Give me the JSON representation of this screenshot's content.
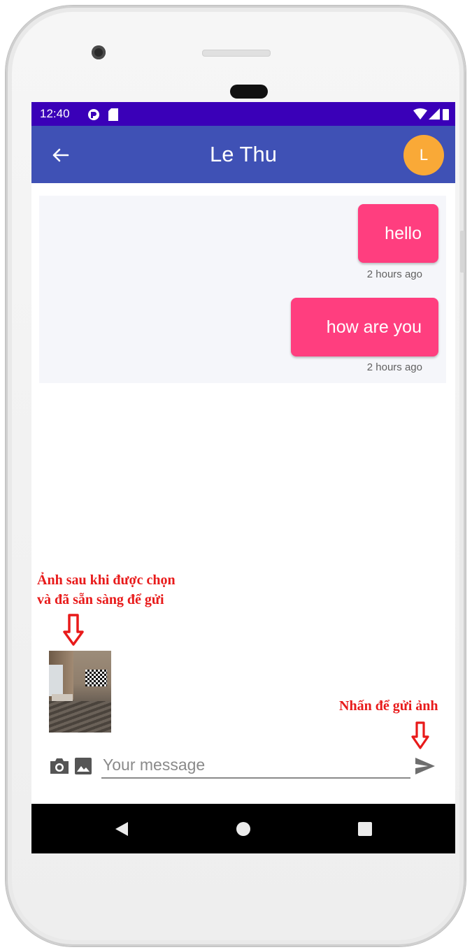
{
  "status_bar": {
    "time": "12:40"
  },
  "app_bar": {
    "title": "Le Thu",
    "avatar_initial": "L"
  },
  "messages": [
    {
      "text": "hello",
      "time": "2 hours ago"
    },
    {
      "text": "how are you",
      "time": "2 hours ago"
    }
  ],
  "composer": {
    "placeholder": "Your message"
  },
  "annotations": {
    "image_note_line1": "Ảnh sau khi được chọn",
    "image_note_line2": "và đã sẵn sàng để gửi",
    "send_note": "Nhấn để gửi ảnh"
  },
  "colors": {
    "status_bar": "#3a00b8",
    "app_bar": "#3f51b5",
    "bubble": "#ff3e7f",
    "avatar": "#f9a937",
    "annotation": "#e81a1a"
  },
  "icons": [
    "back-arrow-icon",
    "camera-icon",
    "image-icon",
    "send-icon",
    "wifi-icon",
    "signal-icon",
    "battery-icon",
    "nav-back-icon",
    "nav-home-icon",
    "nav-recent-icon"
  ]
}
